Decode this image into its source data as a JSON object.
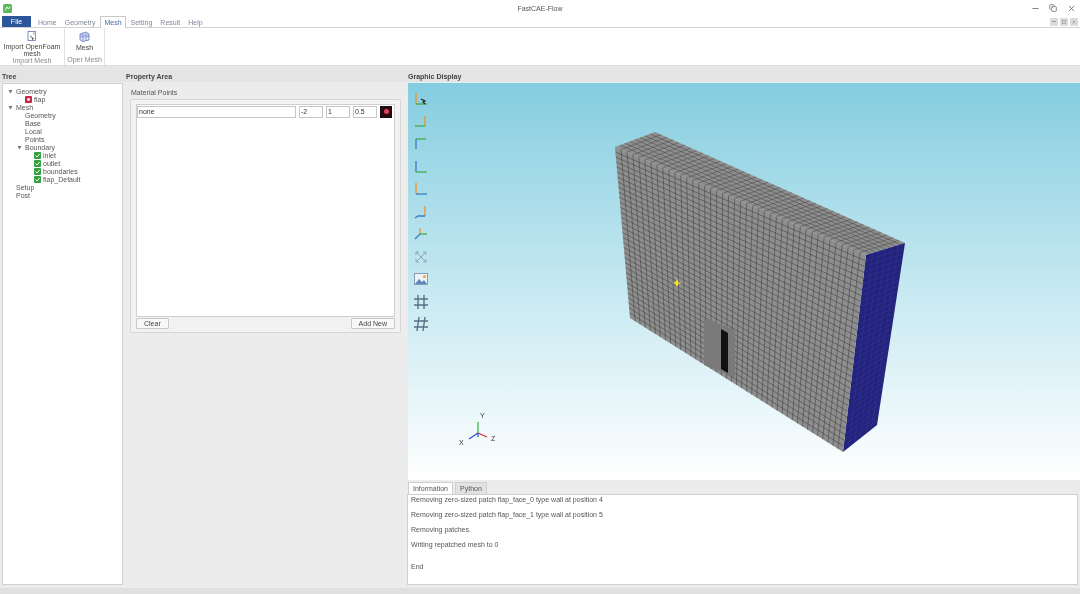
{
  "window": {
    "title": "FastCAE-Flow"
  },
  "menu_tabs": [
    {
      "label": "File",
      "kind": "file",
      "selected": false
    },
    {
      "label": "Home",
      "kind": "tab",
      "selected": false
    },
    {
      "label": "Geometry",
      "kind": "tab",
      "selected": false
    },
    {
      "label": "Mesh",
      "kind": "tab",
      "selected": true
    },
    {
      "label": "Setting",
      "kind": "tab",
      "selected": false
    },
    {
      "label": "Result",
      "kind": "tab",
      "selected": false
    },
    {
      "label": "Help",
      "kind": "tab",
      "selected": false
    }
  ],
  "ribbon_groups": [
    {
      "label": "Import Mesh",
      "buttons": [
        {
          "label": "Import OpenFoam mesh",
          "kind": "import"
        }
      ]
    },
    {
      "label": "Oper Mesh",
      "buttons": [
        {
          "label": "Mesh",
          "kind": "mesh"
        }
      ]
    }
  ],
  "tree": {
    "title": "Tree",
    "items": [
      {
        "label": "Geometry",
        "kind": "branch",
        "expanded": true,
        "children": [
          {
            "label": "flap",
            "kind": "geometry"
          }
        ]
      },
      {
        "label": "Mesh",
        "kind": "branch",
        "expanded": true,
        "children": [
          {
            "label": "Geometry",
            "kind": "leaf"
          },
          {
            "label": "Base",
            "kind": "leaf"
          },
          {
            "label": "Local",
            "kind": "leaf"
          },
          {
            "label": "Points",
            "kind": "leaf"
          },
          {
            "label": "Boundary",
            "kind": "branch",
            "expanded": true,
            "children": [
              {
                "label": "inlet",
                "kind": "check",
                "checked": true
              },
              {
                "label": "outlet",
                "kind": "check",
                "checked": true
              },
              {
                "label": "boundaries",
                "kind": "check",
                "checked": true
              },
              {
                "label": "flap_Default",
                "kind": "check",
                "checked": true
              }
            ]
          }
        ]
      },
      {
        "label": "Setup",
        "kind": "leaf"
      },
      {
        "label": "Post",
        "kind": "leaf"
      }
    ]
  },
  "property_area": {
    "title": "Property Area",
    "group_title": "Material Points",
    "rows": [
      {
        "fields": [
          "none",
          "-2",
          "1",
          "0.5"
        ]
      }
    ],
    "buttons": [
      "Clear",
      "Add New"
    ]
  },
  "graphic_display": {
    "title": "Graphic Display",
    "triad_labels": [
      "Y",
      "X",
      "Z"
    ]
  },
  "output_panel": {
    "tabs": [
      {
        "label": "Information",
        "selected": true
      },
      {
        "label": "Python",
        "selected": false
      }
    ],
    "lines": [
      "Removing zero-sized patch flap_face_0 type wall at position 4",
      "Removing zero-sized patch flap_face_1 type wall at position 5",
      "Removing patches.",
      "Writing repatched mesh to 0",
      "End"
    ]
  }
}
